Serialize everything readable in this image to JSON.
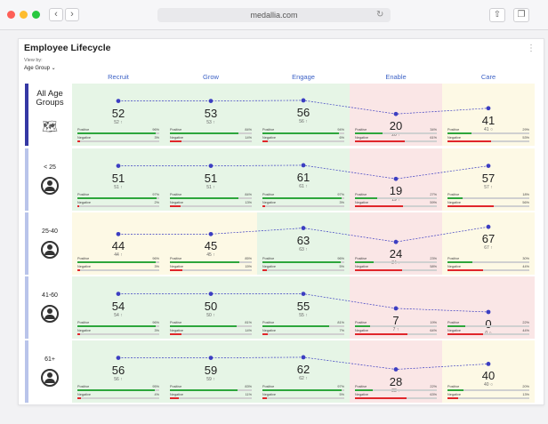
{
  "browser": {
    "url": "medallia.com",
    "nav_back": "‹",
    "nav_forward": "›",
    "reload_icon": "↻",
    "share_icon": "⇧",
    "tabs_icon": "❐"
  },
  "widget": {
    "title": "Employee Lifecycle",
    "view_by_label": "View by:",
    "view_by_value": "Age Group ⌄",
    "menu_icon": "⋮"
  },
  "columns": [
    "Recruit",
    "Grow",
    "Engage",
    "Enable",
    "Care"
  ],
  "colors": {
    "green_bg": "#e6f5e6",
    "yellow_bg": "#fdf9e5",
    "red_bg": "#fae6e6",
    "positive": "#2da63c",
    "negative": "#e0262b",
    "trend_line": "#3c3ec2",
    "accent": "#3e63c6"
  },
  "rows": [
    {
      "label": "All Age Groups",
      "icon": "map-icon",
      "cells": [
        {
          "score": "52",
          "sub": "52 ↑",
          "level": 0.6,
          "bg": "green",
          "pos_label": "Positive",
          "pos_pct": "96%",
          "pos": 0.96,
          "neg_label": "Negative",
          "neg_pct": "3%",
          "neg": 0.03
        },
        {
          "score": "53",
          "sub": "53 ↑",
          "level": 0.6,
          "bg": "green",
          "pos_label": "Positive",
          "pos_pct": "84%",
          "pos": 0.84,
          "neg_label": "Negative",
          "neg_pct": "14%",
          "neg": 0.14
        },
        {
          "score": "56",
          "sub": "56 ↑",
          "level": 0.62,
          "bg": "green",
          "pos_label": "Positive",
          "pos_pct": "94%",
          "pos": 0.94,
          "neg_label": "Negative",
          "neg_pct": "6%",
          "neg": 0.06
        },
        {
          "score": "20",
          "sub": "20 ↑",
          "level": 0.17,
          "bg": "red",
          "pos_label": "Positive",
          "pos_pct": "34%",
          "pos": 0.34,
          "neg_label": "Negative",
          "neg_pct": "61%",
          "neg": 0.61
        },
        {
          "score": "41",
          "sub": "41 ○",
          "level": 0.36,
          "bg": "yellow",
          "pos_label": "Positive",
          "pos_pct": "29%",
          "pos": 0.29,
          "neg_label": "Negative",
          "neg_pct": "53%",
          "neg": 0.53
        }
      ]
    },
    {
      "label": "< 25",
      "icon": "person-icon",
      "cells": [
        {
          "score": "51",
          "sub": "51 ↑",
          "level": 0.6,
          "bg": "green",
          "pos_label": "Positive",
          "pos_pct": "97%",
          "pos": 0.97,
          "neg_label": "Negative",
          "neg_pct": "2%",
          "neg": 0.02
        },
        {
          "score": "51",
          "sub": "51 ↑",
          "level": 0.6,
          "bg": "green",
          "pos_label": "Positive",
          "pos_pct": "84%",
          "pos": 0.84,
          "neg_label": "Negative",
          "neg_pct": "13%",
          "neg": 0.13
        },
        {
          "score": "61",
          "sub": "61 ↑",
          "level": 0.62,
          "bg": "green",
          "pos_label": "Positive",
          "pos_pct": "97%",
          "pos": 0.97,
          "neg_label": "Negative",
          "neg_pct": "3%",
          "neg": 0.03
        },
        {
          "score": "19",
          "sub": "19 ↑",
          "level": 0.17,
          "bg": "red",
          "pos_label": "Positive",
          "pos_pct": "27%",
          "pos": 0.27,
          "neg_label": "Negative",
          "neg_pct": "59%",
          "neg": 0.59
        },
        {
          "score": "57",
          "sub": "57 ↑",
          "level": 0.6,
          "bg": "yellow",
          "pos_label": "Positive",
          "pos_pct": "18%",
          "pos": 0.18,
          "neg_label": "Negative",
          "neg_pct": "56%",
          "neg": 0.56
        }
      ]
    },
    {
      "label": "25-40",
      "icon": "person-icon",
      "cells": [
        {
          "score": "44",
          "sub": "44 ↑",
          "level": 0.46,
          "bg": "yellow",
          "pos_label": "Positive",
          "pos_pct": "96%",
          "pos": 0.96,
          "neg_label": "Negative",
          "neg_pct": "3%",
          "neg": 0.03
        },
        {
          "score": "45",
          "sub": "45 ↑",
          "level": 0.46,
          "bg": "yellow",
          "pos_label": "Positive",
          "pos_pct": "85%",
          "pos": 0.85,
          "neg_label": "Negative",
          "neg_pct": "15%",
          "neg": 0.15
        },
        {
          "score": "63",
          "sub": "63 ↑",
          "level": 0.66,
          "bg": "green",
          "pos_label": "Positive",
          "pos_pct": "96%",
          "pos": 0.96,
          "neg_label": "Negative",
          "neg_pct": "5%",
          "neg": 0.05
        },
        {
          "score": "24",
          "sub": "24 ↑",
          "level": 0.2,
          "bg": "red",
          "pos_label": "Positive",
          "pos_pct": "23%",
          "pos": 0.23,
          "neg_label": "Negative",
          "neg_pct": "58%",
          "neg": 0.58
        },
        {
          "score": "67",
          "sub": "67 ↑",
          "level": 0.7,
          "bg": "yellow",
          "pos_label": "Positive",
          "pos_pct": "30%",
          "pos": 0.3,
          "neg_label": "Negative",
          "neg_pct": "44%",
          "neg": 0.44
        }
      ]
    },
    {
      "label": "41-60",
      "icon": "person-icon",
      "cells": [
        {
          "score": "54",
          "sub": "54 ↑",
          "level": 0.6,
          "bg": "green",
          "pos_label": "Positive",
          "pos_pct": "96%",
          "pos": 0.96,
          "neg_label": "Negative",
          "neg_pct": "3%",
          "neg": 0.03
        },
        {
          "score": "50",
          "sub": "50 ↑",
          "level": 0.6,
          "bg": "green",
          "pos_label": "Positive",
          "pos_pct": "81%",
          "pos": 0.81,
          "neg_label": "Negative",
          "neg_pct": "14%",
          "neg": 0.14
        },
        {
          "score": "55",
          "sub": "55 ↑",
          "level": 0.6,
          "bg": "green",
          "pos_label": "Positive",
          "pos_pct": "81%",
          "pos": 0.81,
          "neg_label": "Negative",
          "neg_pct": "7%",
          "neg": 0.07
        },
        {
          "score": "7",
          "sub": "7 ↑",
          "level": 0.12,
          "bg": "red",
          "pos_label": "Positive",
          "pos_pct": "19%",
          "pos": 0.19,
          "neg_label": "Negative",
          "neg_pct": "64%",
          "neg": 0.64
        },
        {
          "score": "0",
          "sub": "0 ○",
          "level": 0.0,
          "bg": "red",
          "pos_label": "Positive",
          "pos_pct": "22%",
          "pos": 0.22,
          "neg_label": "Negative",
          "neg_pct": "44%",
          "neg": 0.44
        }
      ]
    },
    {
      "label": "61+",
      "icon": "person-icon",
      "cells": [
        {
          "score": "56",
          "sub": "56 ↑",
          "level": 0.6,
          "bg": "green",
          "pos_label": "Positive",
          "pos_pct": "95%",
          "pos": 0.95,
          "neg_label": "Negative",
          "neg_pct": "4%",
          "neg": 0.04
        },
        {
          "score": "59",
          "sub": "59 ↑",
          "level": 0.6,
          "bg": "green",
          "pos_label": "Positive",
          "pos_pct": "83%",
          "pos": 0.83,
          "neg_label": "Negative",
          "neg_pct": "11%",
          "neg": 0.11
        },
        {
          "score": "62",
          "sub": "62 ↑",
          "level": 0.62,
          "bg": "green",
          "pos_label": "Positive",
          "pos_pct": "97%",
          "pos": 0.97,
          "neg_label": "Negative",
          "neg_pct": "5%",
          "neg": 0.05
        },
        {
          "score": "28",
          "sub": "28 ↑",
          "level": 0.22,
          "bg": "red",
          "pos_label": "Positive",
          "pos_pct": "22%",
          "pos": 0.22,
          "neg_label": "Negative",
          "neg_pct": "63%",
          "neg": 0.63
        },
        {
          "score": "40",
          "sub": "40 ○",
          "level": 0.4,
          "bg": "yellow",
          "pos_label": "Positive",
          "pos_pct": "20%",
          "pos": 0.2,
          "neg_label": "Negative",
          "neg_pct": "13%",
          "neg": 0.13
        }
      ]
    }
  ]
}
